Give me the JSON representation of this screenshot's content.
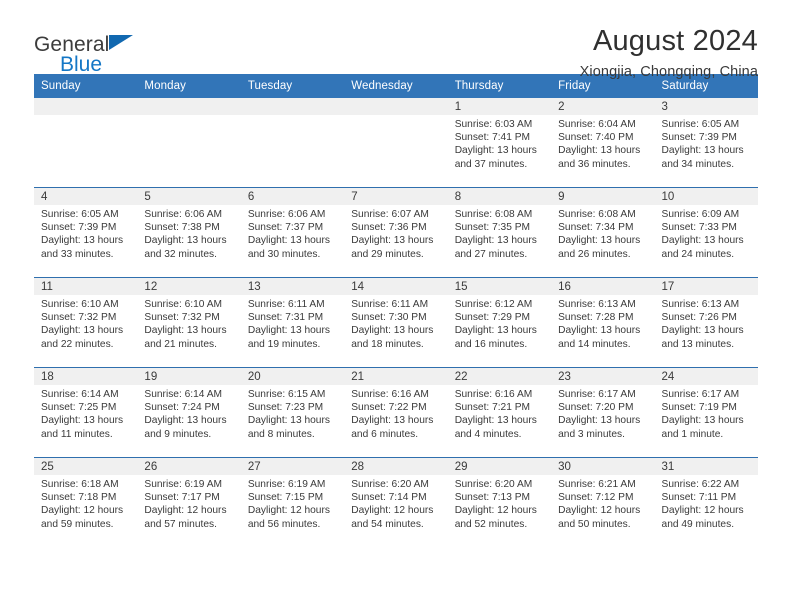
{
  "brand": {
    "name_top": "General",
    "name_bottom": "Blue",
    "triangle_color": "#1168b0",
    "blue_color": "#1477c6"
  },
  "header": {
    "title": "August 2024",
    "subtitle": "Xiongjia, Chongqing, China"
  },
  "theme": {
    "header_bg": "#3275b8",
    "week_divider": "#2f6fae",
    "daynum_band": "#f0f0f0",
    "text": "#3a3a3a"
  },
  "calendar": {
    "weekday_headers": [
      "Sunday",
      "Monday",
      "Tuesday",
      "Wednesday",
      "Thursday",
      "Friday",
      "Saturday"
    ],
    "weeks": [
      [
        {
          "day": "",
          "lines": []
        },
        {
          "day": "",
          "lines": []
        },
        {
          "day": "",
          "lines": []
        },
        {
          "day": "",
          "lines": []
        },
        {
          "day": "1",
          "lines": [
            "Sunrise: 6:03 AM",
            "Sunset: 7:41 PM",
            "Daylight: 13 hours",
            "and 37 minutes."
          ]
        },
        {
          "day": "2",
          "lines": [
            "Sunrise: 6:04 AM",
            "Sunset: 7:40 PM",
            "Daylight: 13 hours",
            "and 36 minutes."
          ]
        },
        {
          "day": "3",
          "lines": [
            "Sunrise: 6:05 AM",
            "Sunset: 7:39 PM",
            "Daylight: 13 hours",
            "and 34 minutes."
          ]
        }
      ],
      [
        {
          "day": "4",
          "lines": [
            "Sunrise: 6:05 AM",
            "Sunset: 7:39 PM",
            "Daylight: 13 hours",
            "and 33 minutes."
          ]
        },
        {
          "day": "5",
          "lines": [
            "Sunrise: 6:06 AM",
            "Sunset: 7:38 PM",
            "Daylight: 13 hours",
            "and 32 minutes."
          ]
        },
        {
          "day": "6",
          "lines": [
            "Sunrise: 6:06 AM",
            "Sunset: 7:37 PM",
            "Daylight: 13 hours",
            "and 30 minutes."
          ]
        },
        {
          "day": "7",
          "lines": [
            "Sunrise: 6:07 AM",
            "Sunset: 7:36 PM",
            "Daylight: 13 hours",
            "and 29 minutes."
          ]
        },
        {
          "day": "8",
          "lines": [
            "Sunrise: 6:08 AM",
            "Sunset: 7:35 PM",
            "Daylight: 13 hours",
            "and 27 minutes."
          ]
        },
        {
          "day": "9",
          "lines": [
            "Sunrise: 6:08 AM",
            "Sunset: 7:34 PM",
            "Daylight: 13 hours",
            "and 26 minutes."
          ]
        },
        {
          "day": "10",
          "lines": [
            "Sunrise: 6:09 AM",
            "Sunset: 7:33 PM",
            "Daylight: 13 hours",
            "and 24 minutes."
          ]
        }
      ],
      [
        {
          "day": "11",
          "lines": [
            "Sunrise: 6:10 AM",
            "Sunset: 7:32 PM",
            "Daylight: 13 hours",
            "and 22 minutes."
          ]
        },
        {
          "day": "12",
          "lines": [
            "Sunrise: 6:10 AM",
            "Sunset: 7:32 PM",
            "Daylight: 13 hours",
            "and 21 minutes."
          ]
        },
        {
          "day": "13",
          "lines": [
            "Sunrise: 6:11 AM",
            "Sunset: 7:31 PM",
            "Daylight: 13 hours",
            "and 19 minutes."
          ]
        },
        {
          "day": "14",
          "lines": [
            "Sunrise: 6:11 AM",
            "Sunset: 7:30 PM",
            "Daylight: 13 hours",
            "and 18 minutes."
          ]
        },
        {
          "day": "15",
          "lines": [
            "Sunrise: 6:12 AM",
            "Sunset: 7:29 PM",
            "Daylight: 13 hours",
            "and 16 minutes."
          ]
        },
        {
          "day": "16",
          "lines": [
            "Sunrise: 6:13 AM",
            "Sunset: 7:28 PM",
            "Daylight: 13 hours",
            "and 14 minutes."
          ]
        },
        {
          "day": "17",
          "lines": [
            "Sunrise: 6:13 AM",
            "Sunset: 7:26 PM",
            "Daylight: 13 hours",
            "and 13 minutes."
          ]
        }
      ],
      [
        {
          "day": "18",
          "lines": [
            "Sunrise: 6:14 AM",
            "Sunset: 7:25 PM",
            "Daylight: 13 hours",
            "and 11 minutes."
          ]
        },
        {
          "day": "19",
          "lines": [
            "Sunrise: 6:14 AM",
            "Sunset: 7:24 PM",
            "Daylight: 13 hours",
            "and 9 minutes."
          ]
        },
        {
          "day": "20",
          "lines": [
            "Sunrise: 6:15 AM",
            "Sunset: 7:23 PM",
            "Daylight: 13 hours",
            "and 8 minutes."
          ]
        },
        {
          "day": "21",
          "lines": [
            "Sunrise: 6:16 AM",
            "Sunset: 7:22 PM",
            "Daylight: 13 hours",
            "and 6 minutes."
          ]
        },
        {
          "day": "22",
          "lines": [
            "Sunrise: 6:16 AM",
            "Sunset: 7:21 PM",
            "Daylight: 13 hours",
            "and 4 minutes."
          ]
        },
        {
          "day": "23",
          "lines": [
            "Sunrise: 6:17 AM",
            "Sunset: 7:20 PM",
            "Daylight: 13 hours",
            "and 3 minutes."
          ]
        },
        {
          "day": "24",
          "lines": [
            "Sunrise: 6:17 AM",
            "Sunset: 7:19 PM",
            "Daylight: 13 hours",
            "and 1 minute."
          ]
        }
      ],
      [
        {
          "day": "25",
          "lines": [
            "Sunrise: 6:18 AM",
            "Sunset: 7:18 PM",
            "Daylight: 12 hours",
            "and 59 minutes."
          ]
        },
        {
          "day": "26",
          "lines": [
            "Sunrise: 6:19 AM",
            "Sunset: 7:17 PM",
            "Daylight: 12 hours",
            "and 57 minutes."
          ]
        },
        {
          "day": "27",
          "lines": [
            "Sunrise: 6:19 AM",
            "Sunset: 7:15 PM",
            "Daylight: 12 hours",
            "and 56 minutes."
          ]
        },
        {
          "day": "28",
          "lines": [
            "Sunrise: 6:20 AM",
            "Sunset: 7:14 PM",
            "Daylight: 12 hours",
            "and 54 minutes."
          ]
        },
        {
          "day": "29",
          "lines": [
            "Sunrise: 6:20 AM",
            "Sunset: 7:13 PM",
            "Daylight: 12 hours",
            "and 52 minutes."
          ]
        },
        {
          "day": "30",
          "lines": [
            "Sunrise: 6:21 AM",
            "Sunset: 7:12 PM",
            "Daylight: 12 hours",
            "and 50 minutes."
          ]
        },
        {
          "day": "31",
          "lines": [
            "Sunrise: 6:22 AM",
            "Sunset: 7:11 PM",
            "Daylight: 12 hours",
            "and 49 minutes."
          ]
        }
      ]
    ]
  }
}
